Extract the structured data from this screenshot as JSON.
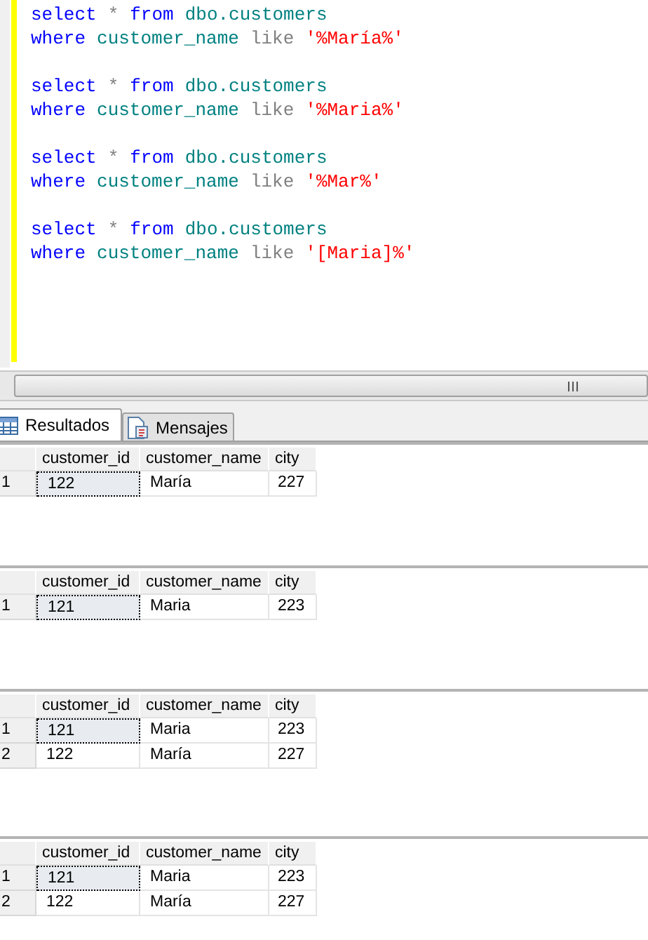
{
  "editor": {
    "queries": [
      {
        "lines": [
          [
            {
              "kind": "keyword",
              "text": "select"
            },
            {
              "kind": "operator",
              "text": "*"
            },
            {
              "kind": "keyword",
              "text": "from"
            },
            {
              "kind": "object",
              "text": "dbo.customers"
            }
          ],
          [
            {
              "kind": "keyword",
              "text": "where"
            },
            {
              "kind": "object",
              "text": "customer_name"
            },
            {
              "kind": "operator",
              "text": "like"
            },
            {
              "kind": "string",
              "text": "'%María%'"
            }
          ]
        ]
      },
      {
        "lines": [
          [
            {
              "kind": "keyword",
              "text": "select"
            },
            {
              "kind": "operator",
              "text": "*"
            },
            {
              "kind": "keyword",
              "text": "from"
            },
            {
              "kind": "object",
              "text": "dbo.customers"
            }
          ],
          [
            {
              "kind": "keyword",
              "text": "where"
            },
            {
              "kind": "object",
              "text": "customer_name"
            },
            {
              "kind": "operator",
              "text": "like"
            },
            {
              "kind": "string",
              "text": "'%Maria%'"
            }
          ]
        ]
      },
      {
        "lines": [
          [
            {
              "kind": "keyword",
              "text": "select"
            },
            {
              "kind": "operator",
              "text": "*"
            },
            {
              "kind": "keyword",
              "text": "from"
            },
            {
              "kind": "object",
              "text": "dbo.customers"
            }
          ],
          [
            {
              "kind": "keyword",
              "text": "where"
            },
            {
              "kind": "object",
              "text": "customer_name"
            },
            {
              "kind": "operator",
              "text": "like"
            },
            {
              "kind": "string",
              "text": "'%Mar%'"
            }
          ]
        ]
      },
      {
        "lines": [
          [
            {
              "kind": "keyword",
              "text": "select"
            },
            {
              "kind": "operator",
              "text": "*"
            },
            {
              "kind": "keyword",
              "text": "from"
            },
            {
              "kind": "object",
              "text": "dbo.customers"
            }
          ],
          [
            {
              "kind": "keyword",
              "text": "where"
            },
            {
              "kind": "object",
              "text": "customer_name"
            },
            {
              "kind": "operator",
              "text": "like"
            },
            {
              "kind": "string",
              "text": "'[Maria]%'"
            }
          ]
        ]
      }
    ]
  },
  "tabs": [
    {
      "label": "Resultados",
      "selected": true,
      "kind": "grid"
    },
    {
      "label": "Mensajes",
      "selected": false,
      "kind": "messages"
    }
  ],
  "results": [
    {
      "columns": [
        "customer_id",
        "customer_name",
        "city"
      ],
      "rows": [
        {
          "number": "1",
          "cells": [
            "122",
            "María",
            "227"
          ],
          "focused": true
        }
      ]
    },
    {
      "columns": [
        "customer_id",
        "customer_name",
        "city"
      ],
      "rows": [
        {
          "number": "1",
          "cells": [
            "121",
            "Maria",
            "223"
          ],
          "focused": true
        }
      ]
    },
    {
      "columns": [
        "customer_id",
        "customer_name",
        "city"
      ],
      "rows": [
        {
          "number": "1",
          "cells": [
            "121",
            "Maria",
            "223"
          ],
          "focused": true
        },
        {
          "number": "2",
          "cells": [
            "122",
            "María",
            "227"
          ],
          "focused": false
        }
      ]
    },
    {
      "columns": [
        "customer_id",
        "customer_name",
        "city"
      ],
      "rows": [
        {
          "number": "1",
          "cells": [
            "121",
            "Maria",
            "223"
          ],
          "focused": true
        },
        {
          "number": "2",
          "cells": [
            "122",
            "María",
            "227"
          ],
          "focused": false
        }
      ]
    }
  ]
}
